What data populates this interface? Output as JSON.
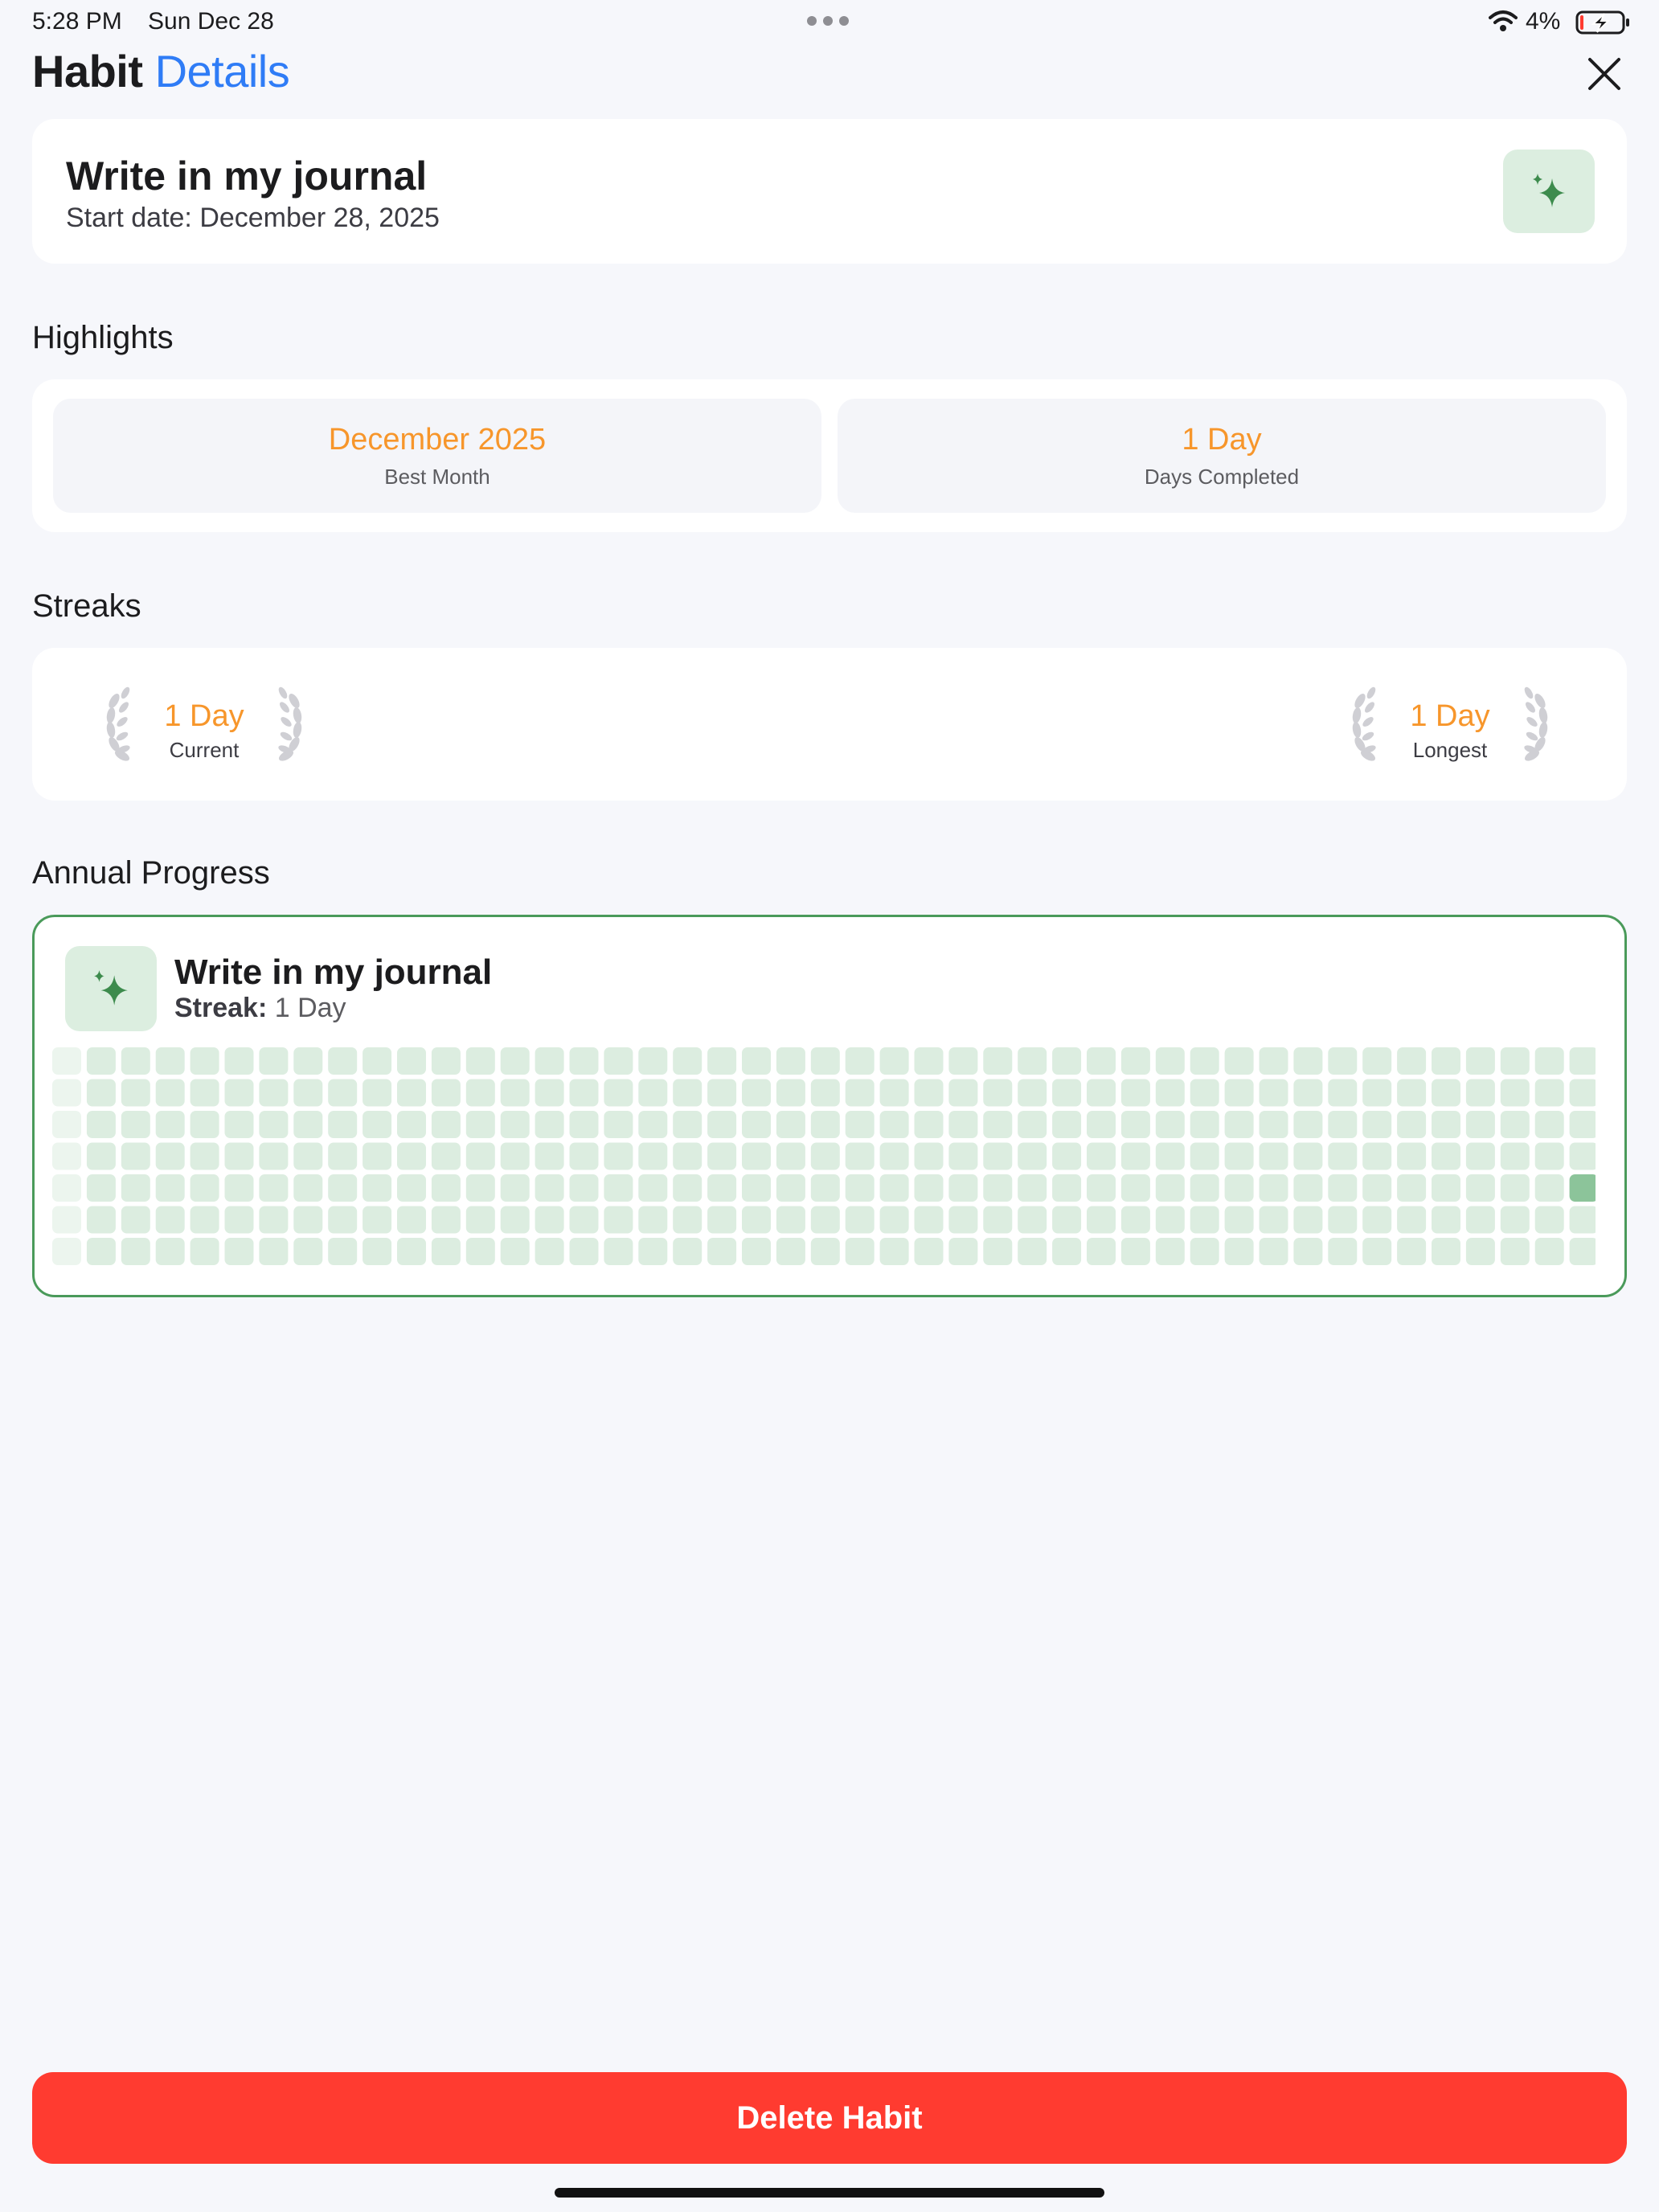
{
  "status_bar": {
    "time": "5:28 PM",
    "date": "Sun Dec 28",
    "battery_percent": "4%",
    "battery_level": 0.04,
    "charging": true
  },
  "header": {
    "title_part1": "Habit",
    "title_part2": "Details",
    "accent_color": "#2f7cf6",
    "close_icon": "close-icon"
  },
  "habit": {
    "name": "Write in my journal",
    "start_date": "Start date: December 28, 2025",
    "icon": "sparkles-icon",
    "icon_color": "#3d8b4d"
  },
  "highlights": {
    "section_title": "Highlights",
    "items": [
      {
        "value": "December 2025",
        "label": "Best Month"
      },
      {
        "value": "1 Day",
        "label": "Days Completed"
      }
    ],
    "value_color": "#f7962b"
  },
  "streaks": {
    "section_title": "Streaks",
    "current": {
      "value": "1 Day",
      "label": "Current"
    },
    "longest": {
      "value": "1 Day",
      "label": "Longest"
    }
  },
  "annual_progress": {
    "section_title": "Annual Progress",
    "habit_name": "Write in my journal",
    "streak_label": "Streak:",
    "streak_value": "1 Day",
    "grid": {
      "rows": 7,
      "columns": 45,
      "completed_cells": [
        [
          44,
          4
        ]
      ],
      "empty_color": "#dcede0",
      "filled_color": "#8cc49a"
    }
  },
  "footer": {
    "delete_label": "Delete Habit",
    "delete_color": "#ff3b30"
  }
}
